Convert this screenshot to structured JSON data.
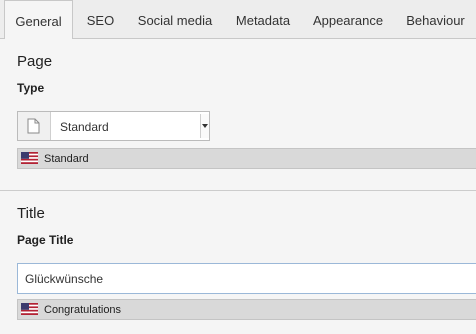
{
  "tabs": [
    {
      "label": "General",
      "active": true
    },
    {
      "label": "SEO"
    },
    {
      "label": "Social media"
    },
    {
      "label": "Metadata"
    },
    {
      "label": "Appearance"
    },
    {
      "label": "Behaviour"
    }
  ],
  "page_section": {
    "heading": "Page",
    "type_label": "Type",
    "type_value": "Standard",
    "type_translation": "Standard"
  },
  "title_section": {
    "heading": "Title",
    "page_title_label": "Page Title",
    "page_title_value": "Glückwünsche",
    "page_title_translation": "Congratulations"
  },
  "icons": {
    "type_icon": "page-icon",
    "language_flag": "us-flag-icon",
    "dropdown": "chevron-down-icon"
  }
}
